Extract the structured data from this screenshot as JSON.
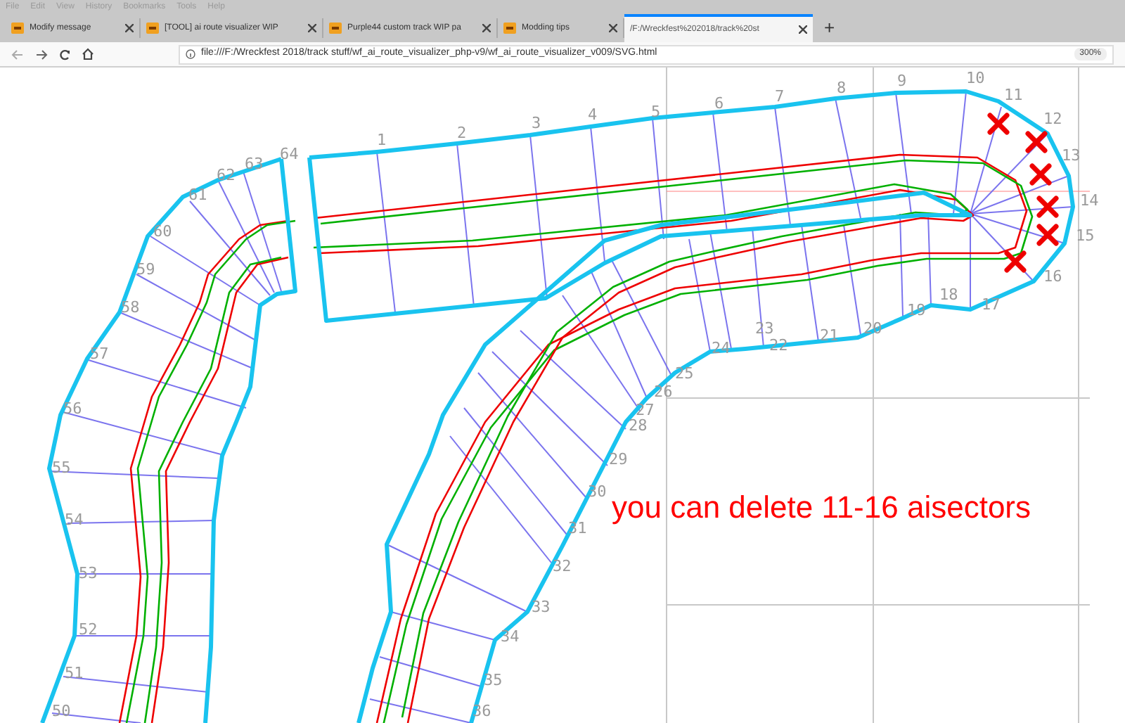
{
  "browser": {
    "menu": [
      "File",
      "Edit",
      "View",
      "History",
      "Bookmarks",
      "Tools",
      "Help"
    ],
    "tabs": [
      {
        "title": "Modify message",
        "selected": false
      },
      {
        "title": "[TOOL] ai route visualizer WIP",
        "selected": false
      },
      {
        "title": "Purple44 custom track WIP pa",
        "selected": false
      },
      {
        "title": "Modding tips",
        "selected": false
      },
      {
        "title": "/F:/Wreckfest%202018/track%20st",
        "selected": true
      }
    ],
    "new_tab": "+",
    "address_bar": {
      "url": "file:///F:/Wreckfest 2018/track stuff/wf_ai_route_visualizer_php-v9/wf_ai_route_visualizer_v009/SVG.html",
      "zoom": "300%"
    }
  },
  "canvas": {
    "sector_labels": [
      "1",
      "2",
      "3",
      "4",
      "5",
      "6",
      "7",
      "8",
      "9",
      "10",
      "11",
      "12",
      "13",
      "14",
      "15",
      "16",
      "17",
      "18",
      "19",
      "20",
      "21",
      "22",
      "23",
      "24",
      "25",
      "26",
      "27",
      "28",
      "29",
      "30",
      "31",
      "32",
      "33",
      "34",
      "35",
      "36",
      "50",
      "51",
      "52",
      "53",
      "54",
      "55",
      "56",
      "57",
      "58",
      "59",
      "60",
      "61",
      "62",
      "63",
      "64"
    ],
    "annotation": "you can delete 11-16 aisectors"
  }
}
